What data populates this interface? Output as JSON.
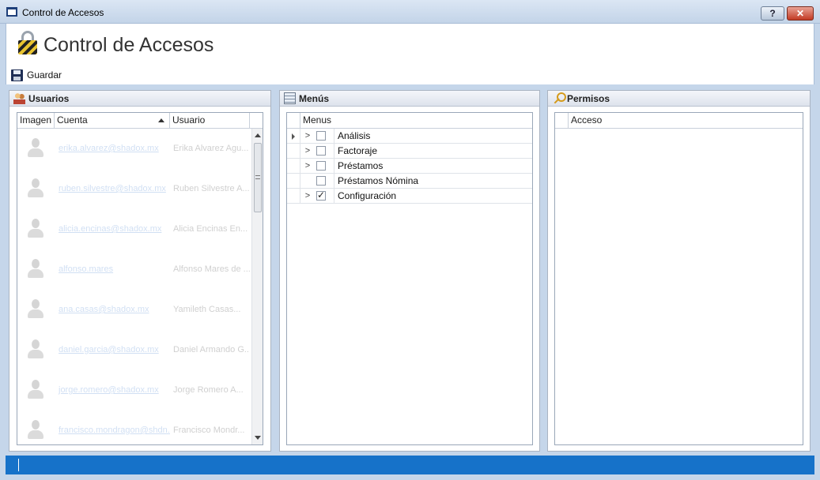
{
  "window": {
    "title": "Control de Accesos",
    "help_label": "?",
    "close_label": "✕"
  },
  "header": {
    "title": "Control de Accesos",
    "save_label": "Guardar"
  },
  "usuarios": {
    "title": "Usuarios",
    "columns": [
      "Imagen",
      "Cuenta",
      "Usuario"
    ],
    "rows": [
      {
        "cuenta": "erika.alvarez@shadox.mx",
        "usuario": "Erika Alvarez Agu..."
      },
      {
        "cuenta": "ruben.silvestre@shadox.mx",
        "usuario": "Ruben Silvestre A..."
      },
      {
        "cuenta": "alicia.encinas@shadox.mx",
        "usuario": "Alicia Encinas En..."
      },
      {
        "cuenta": "alfonso.mares",
        "usuario": "Alfonso Mares de ..."
      },
      {
        "cuenta": "ana.casas@shadox.mx",
        "usuario": "Yamileth Casas..."
      },
      {
        "cuenta": "daniel.garcia@shadox.mx",
        "usuario": "Daniel Armando G..."
      },
      {
        "cuenta": "jorge.romero@shadox.mx",
        "usuario": "Jorge Romero A..."
      },
      {
        "cuenta": "francisco.mondragon@shdn...",
        "usuario": "Francisco Mondr..."
      }
    ]
  },
  "menus": {
    "title": "Menús",
    "column": "Menus",
    "items": [
      {
        "label": "Análisis",
        "expandable": true,
        "checked": false,
        "current": true
      },
      {
        "label": "Factoraje",
        "expandable": true,
        "checked": false,
        "current": false
      },
      {
        "label": "Préstamos",
        "expandable": true,
        "checked": false,
        "current": false
      },
      {
        "label": "Préstamos Nómina",
        "expandable": false,
        "checked": false,
        "current": false
      },
      {
        "label": "Configuración",
        "expandable": true,
        "checked": true,
        "current": false
      }
    ]
  },
  "permisos": {
    "title": "Permisos",
    "column": "Acceso"
  },
  "colors": {
    "statusbar": "#1672c9",
    "background": "#c5d6ea"
  }
}
